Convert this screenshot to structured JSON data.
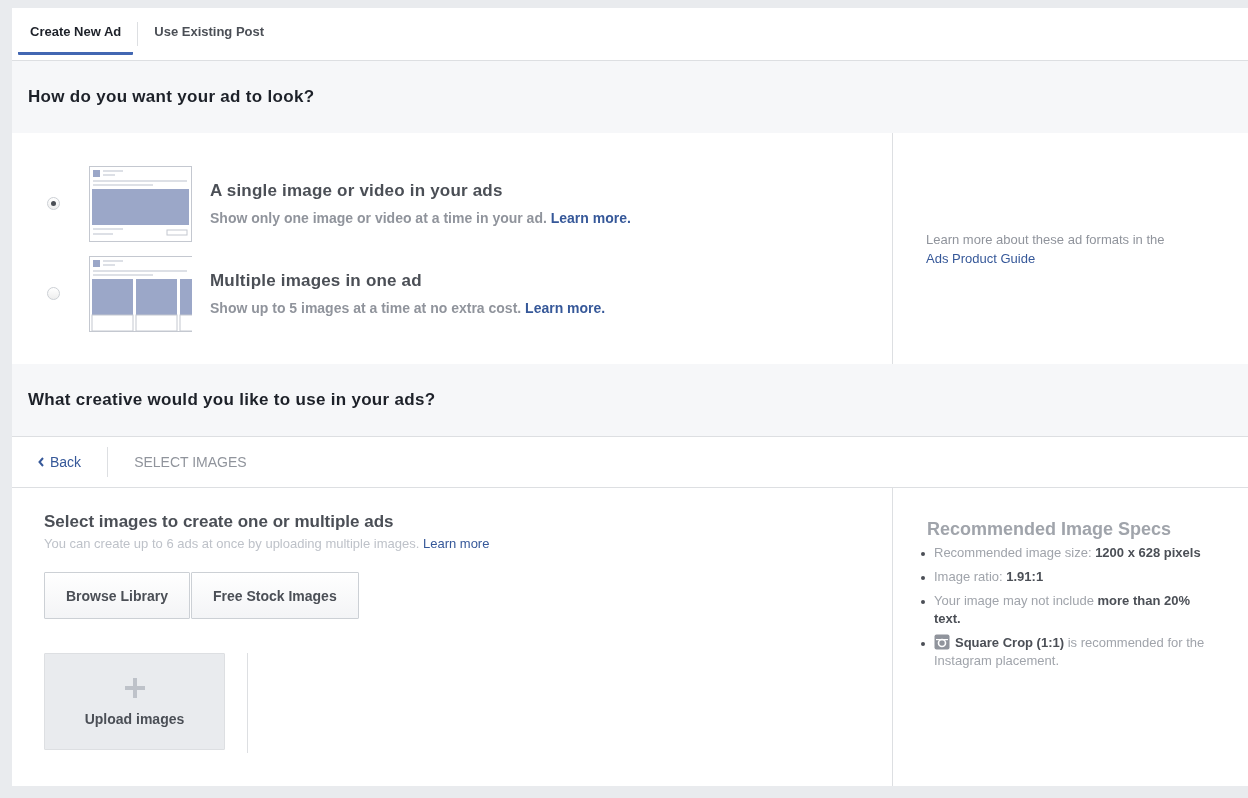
{
  "tabs": [
    {
      "label": "Create New Ad",
      "selected": true
    },
    {
      "label": "Use Existing Post",
      "selected": false
    }
  ],
  "format_heading": "How do you want your ad to look?",
  "formats": [
    {
      "kind": "single",
      "title": "A single image or video in your ads",
      "description": "Show only one image or video at a time in your ad.",
      "link": "Learn more.",
      "selected": true
    },
    {
      "kind": "carousel",
      "title": "Multiple images in one ad",
      "description": "Show up to 5 images at a time at no extra cost.",
      "link": "Learn more.",
      "selected": false
    }
  ],
  "format_note": {
    "text": "Learn more about these ad formats in the",
    "link": "Ads Product Guide"
  },
  "creative_heading": "What creative would you like to use in your ads?",
  "nav": {
    "back": "Back",
    "step": "SELECT IMAGES"
  },
  "select": {
    "title": "Select images to create one or multiple ads",
    "hint": "You can create up to 6 ads at once by uploading multiple images.",
    "hint_link": "Learn more",
    "buttons": [
      "Browse Library",
      "Free Stock Images"
    ],
    "upload": "Upload images"
  },
  "specs": {
    "title": "Recommended Image Specs",
    "items": [
      {
        "kind": "plain",
        "text": "Recommended image size: **1200 x 628 pixels**"
      },
      {
        "kind": "plain",
        "text": "Image ratio: **1.91:1**"
      },
      {
        "kind": "plain",
        "text": "Your image may not include **more than 20% text.**"
      },
      {
        "kind": "instagram",
        "text": "**Square Crop (1:1)** is recommended for the Instagram placement."
      }
    ]
  }
}
